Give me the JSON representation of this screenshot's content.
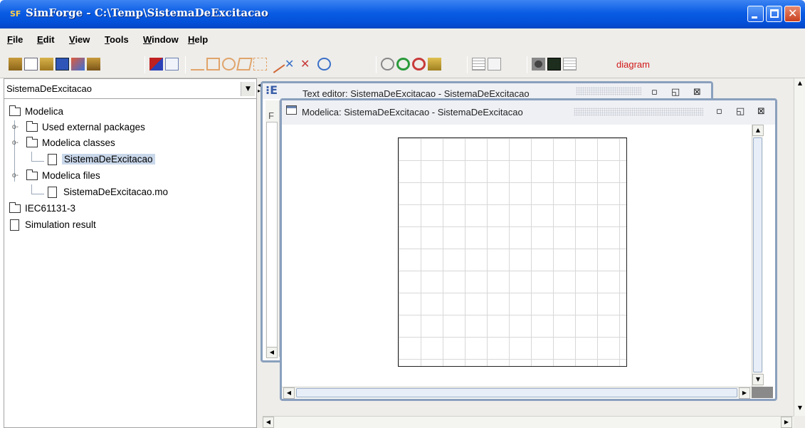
{
  "window": {
    "title": "SimForge - C:\\Temp\\SistemaDeExcitacao",
    "app_icon": "SF"
  },
  "menubar": [
    {
      "label": "File",
      "mnemonic": "F",
      "rest": "ile"
    },
    {
      "label": "Edit",
      "mnemonic": "E",
      "rest": "dit"
    },
    {
      "label": "View",
      "mnemonic": "V",
      "rest": "iew"
    },
    {
      "label": "Tools",
      "mnemonic": "T",
      "rest": "ools"
    },
    {
      "label": "Window",
      "mnemonic": "W",
      "rest": "indow"
    },
    {
      "label": "Help",
      "mnemonic": "H",
      "rest": "elp"
    }
  ],
  "toolbar": {
    "mode_label": "diagram",
    "icons": [
      "new-package-icon",
      "new-file-icon",
      "open-icon",
      "save-icon",
      "save-all-icon",
      "close-file-icon",
      "check-icon",
      "copy-icon",
      "line-icon",
      "rectangle-icon",
      "ellipse-icon",
      "polygon-icon",
      "text-icon",
      "connect-icon",
      "tools-icon",
      "settings-icon",
      "rotate-icon",
      "zoom-icon",
      "zoom-in-icon",
      "zoom-out-icon",
      "fit-icon",
      "list-icon",
      "parameter-icon",
      "simulate-icon",
      "plot-icon",
      "log-icon"
    ]
  },
  "project_combo": "SistemaDeExcitacao",
  "tree": [
    {
      "label": "Modelica"
    },
    {
      "label": "Used external packages"
    },
    {
      "label": "Modelica classes"
    },
    {
      "label": "SistemaDeExcitacao"
    },
    {
      "label": "Modelica files"
    },
    {
      "label": "SistemaDeExcitacao.mo"
    },
    {
      "label": "IEC61131-3"
    },
    {
      "label": "Simulation result"
    }
  ],
  "text_editor": {
    "title": "Text editor: SistemaDeExcitacao - SistemaDeExcitacao"
  },
  "diagram_window": {
    "title": "Modelica: SistemaDeExcitacao - SistemaDeExcitacao"
  },
  "colors": {
    "titlebar": "#0a5ce4",
    "diagram_label": "#d01818",
    "frame_border": "#8aa0bd"
  }
}
